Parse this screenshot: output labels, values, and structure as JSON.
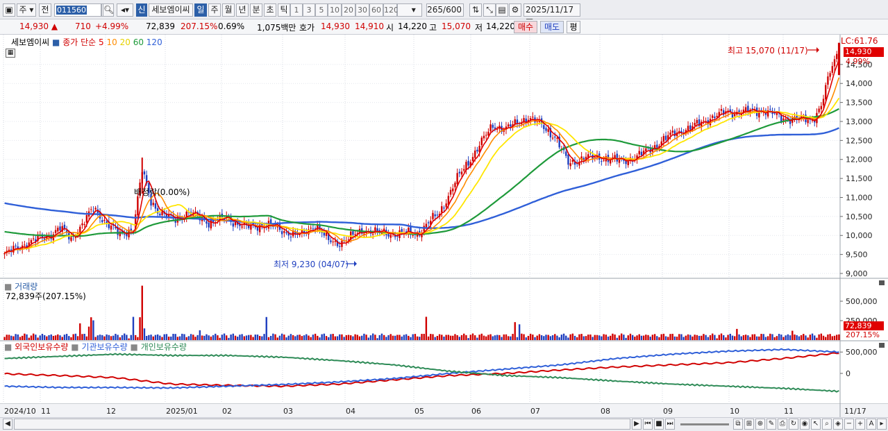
{
  "toolbar": {
    "type_label": "주",
    "mode_label": "전",
    "code": "011560",
    "new_label": "신",
    "stock_name": "세보엠이씨",
    "periods": [
      "일",
      "주",
      "월",
      "년",
      "분",
      "초",
      "틱"
    ],
    "selected_period": "일",
    "intervals": [
      "1",
      "3",
      "5",
      "10",
      "20",
      "30",
      "60",
      "120"
    ],
    "count": "265",
    "count_total": "/600",
    "date": "2025/11/17"
  },
  "quote": {
    "price": "14,930",
    "change": "710",
    "change_pct": "+4.99%",
    "volume": "72,839",
    "volume_ratio": "207.15%",
    "turnover": "0.69%",
    "amount": "1,075백만",
    "quote_label": "호가",
    "ask": "14,930",
    "bid": "14,910",
    "open_label": "시",
    "open": "14,220",
    "high_label": "고",
    "high": "15,070",
    "low_label": "저",
    "low": "14,220",
    "buy_label": "매수",
    "sell_label": "매도",
    "avg_label": "평"
  },
  "colors": {
    "up": "#d00000",
    "down": "#1f3fbf",
    "ma5": "#e00000",
    "ma10": "#ff8c00",
    "ma20": "#ffe600",
    "ma60": "#1e9a3a",
    "ma120": "#2f5fd8",
    "foreign": "#d00000",
    "institution": "#2f5fd8",
    "individual": "#2e8b57"
  },
  "price_panel": {
    "legend_name": "세보엠이씨",
    "legend_series": "종가 단순",
    "ma_periods": [
      "5",
      "10",
      "20",
      "60",
      "120"
    ],
    "lc": "LC:61.76",
    "current_price_tag": "14,930",
    "current_pct_tag": "4.99%",
    "high_annotation": "최고 15,070 (11/17)",
    "low_annotation": "최저 9,230 (04/07)",
    "rights_annotation": "배정락(0.00%)",
    "y_ticks": [
      "14,500",
      "14,000",
      "13,500",
      "13,000",
      "12,500",
      "12,000",
      "11,500",
      "11,000",
      "10,500",
      "10,000",
      "9,500",
      "9,000"
    ]
  },
  "volume_panel": {
    "title": "거래량",
    "value_label": "72,839주(207.15%)",
    "y_ticks": [
      "500,000",
      "250,000"
    ],
    "current_tag": "72,839",
    "current_pct": "207.15%"
  },
  "holdings_panel": {
    "legend": [
      "외국인보유수량",
      "기관보유수량",
      "개인보유수량"
    ],
    "y_ticks": [
      "500,000",
      "0"
    ]
  },
  "x_axis": {
    "labels": [
      "2024/10",
      "11",
      "12",
      "2025/01",
      "02",
      "03",
      "04",
      "05",
      "06",
      "07",
      "08",
      "09",
      "10",
      "11"
    ],
    "end_label": "11/17"
  },
  "chart_data": {
    "type": "candlestick",
    "title": "세보엠이씨",
    "x_start": "2024/10",
    "x_end": "2025/11/17",
    "price_range": [
      9000,
      15100
    ],
    "high": {
      "value": 15070,
      "date": "11/17"
    },
    "low": {
      "value": 9230,
      "date": "04/07"
    },
    "close_keypoints": [
      [
        0,
        9500
      ],
      [
        10,
        9800
      ],
      [
        20,
        10000
      ],
      [
        25,
        10200
      ],
      [
        30,
        9900
      ],
      [
        40,
        10700
      ],
      [
        45,
        10400
      ],
      [
        52,
        10000
      ],
      [
        58,
        10200
      ],
      [
        62,
        11700
      ],
      [
        66,
        10900
      ],
      [
        70,
        10600
      ],
      [
        76,
        10400
      ],
      [
        83,
        10600
      ],
      [
        92,
        10350
      ],
      [
        100,
        10450
      ],
      [
        110,
        10200
      ],
      [
        118,
        10300
      ],
      [
        126,
        10100
      ],
      [
        134,
        10000
      ],
      [
        140,
        10300
      ],
      [
        146,
        9850
      ],
      [
        150,
        9800
      ],
      [
        156,
        9950
      ],
      [
        162,
        10150
      ],
      [
        170,
        10050
      ],
      [
        178,
        10050
      ],
      [
        186,
        10050
      ],
      [
        196,
        10600
      ],
      [
        204,
        11500
      ],
      [
        212,
        12200
      ],
      [
        220,
        12900
      ],
      [
        226,
        12800
      ],
      [
        232,
        13000
      ],
      [
        236,
        13100
      ],
      [
        242,
        12900
      ],
      [
        248,
        12600
      ],
      [
        254,
        11900
      ],
      [
        262,
        12050
      ],
      [
        270,
        12050
      ],
      [
        278,
        11950
      ],
      [
        286,
        12100
      ],
      [
        294,
        12400
      ],
      [
        302,
        12700
      ],
      [
        310,
        12850
      ],
      [
        318,
        13100
      ],
      [
        326,
        13250
      ],
      [
        334,
        13250
      ],
      [
        342,
        13300
      ],
      [
        350,
        13100
      ],
      [
        358,
        13050
      ],
      [
        364,
        13050
      ],
      [
        368,
        13400
      ],
      [
        372,
        14300
      ],
      [
        376,
        14930
      ]
    ],
    "moving_averages": [
      "5",
      "10",
      "20",
      "60",
      "120"
    ],
    "volume_last": 72839,
    "volume_ratio": "207.15%",
    "volume_ylim": [
      0,
      750000
    ],
    "holdings_series": [
      {
        "name": "외국인보유수량",
        "values": [
          -10000,
          -50000,
          -100000,
          -250000,
          -280000,
          -300000,
          -250000,
          -150000,
          -50000,
          0,
          80000,
          150000,
          200000,
          250000,
          350000,
          480000
        ]
      },
      {
        "name": "기관보유수량",
        "values": [
          -300000,
          -330000,
          -330000,
          -340000,
          -300000,
          -260000,
          -200000,
          -120000,
          0,
          100000,
          200000,
          350000,
          450000,
          520000,
          560000,
          500000
        ]
      },
      {
        "name": "개인보유수량",
        "values": [
          350000,
          400000,
          450000,
          420000,
          420000,
          380000,
          300000,
          200000,
          50000,
          -50000,
          -100000,
          -180000,
          -250000,
          -300000,
          -350000,
          -420000
        ]
      }
    ]
  }
}
